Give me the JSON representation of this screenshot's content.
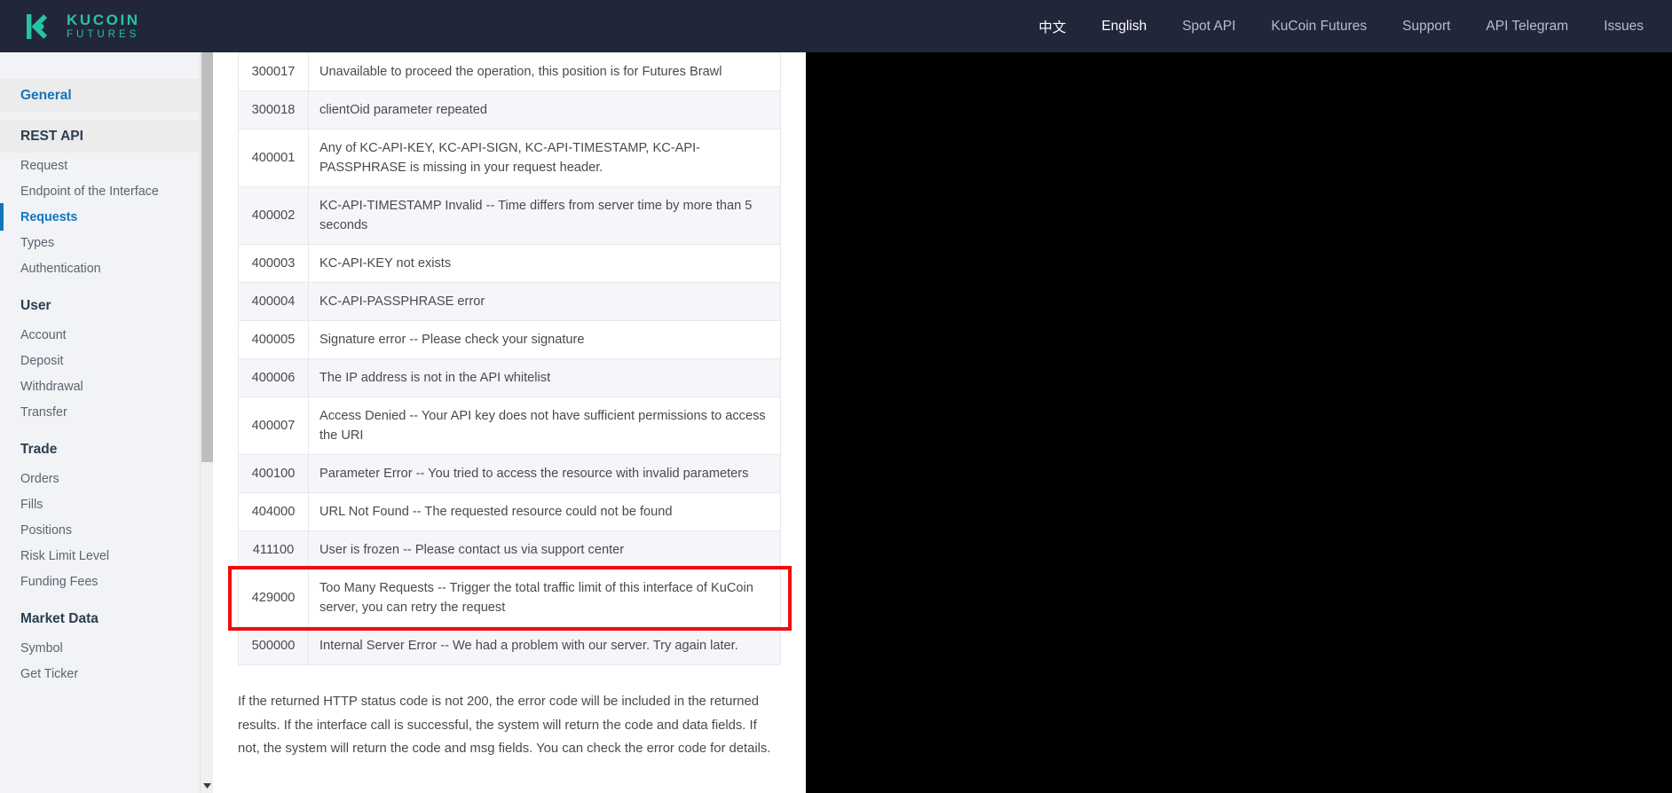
{
  "header": {
    "brand": {
      "title": "KUCOIN",
      "subtitle": "FUTURES",
      "logo_icon": "kucoin-k-logo",
      "color": "#27c3a4"
    },
    "nav": [
      {
        "label": "中文",
        "name": "nav-link-chinese",
        "active": false
      },
      {
        "label": "English",
        "name": "nav-link-english",
        "active": true
      },
      {
        "label": "Spot API",
        "name": "nav-link-spot-api",
        "active": false
      },
      {
        "label": "KuCoin Futures",
        "name": "nav-link-kucoin-futures",
        "active": false
      },
      {
        "label": "Support",
        "name": "nav-link-support",
        "active": false
      },
      {
        "label": "API Telegram",
        "name": "nav-link-api-telegram",
        "active": false
      },
      {
        "label": "Issues",
        "name": "nav-link-issues",
        "active": false
      }
    ],
    "background": "#222639"
  },
  "sidebar": {
    "groups": [
      {
        "title": "General",
        "style": "shaded-link",
        "items": []
      },
      {
        "title": "REST API",
        "style": "shaded",
        "items": [
          {
            "label": "Request",
            "active": false
          },
          {
            "label": "Endpoint of the Interface",
            "active": false
          },
          {
            "label": "Requests",
            "active": true
          },
          {
            "label": "Types",
            "active": false
          },
          {
            "label": "Authentication",
            "active": false
          }
        ]
      },
      {
        "title": "User",
        "style": "plain",
        "items": [
          {
            "label": "Account",
            "active": false
          },
          {
            "label": "Deposit",
            "active": false
          },
          {
            "label": "Withdrawal",
            "active": false
          },
          {
            "label": "Transfer",
            "active": false
          }
        ]
      },
      {
        "title": "Trade",
        "style": "plain",
        "items": [
          {
            "label": "Orders",
            "active": false
          },
          {
            "label": "Fills",
            "active": false
          },
          {
            "label": "Positions",
            "active": false
          },
          {
            "label": "Risk Limit Level",
            "active": false
          },
          {
            "label": "Funding Fees",
            "active": false
          }
        ]
      },
      {
        "title": "Market Data",
        "style": "plain",
        "items": [
          {
            "label": "Symbol",
            "active": false
          },
          {
            "label": "Get Ticker",
            "active": false
          }
        ]
      }
    ],
    "active_accent": "#1176bc"
  },
  "scrollbar": {
    "name": "sidebar-scrollbar",
    "down_arrow_icon": "chevron-down-icon"
  },
  "main": {
    "error_table": {
      "rows": [
        {
          "code": "300017",
          "message": "Unavailable to proceed the operation, this position is for Futures Brawl"
        },
        {
          "code": "300018",
          "message": "clientOid parameter repeated"
        },
        {
          "code": "400001",
          "message": "Any of KC-API-KEY, KC-API-SIGN, KC-API-TIMESTAMP, KC-API-PASSPHRASE is missing in your request header."
        },
        {
          "code": "400002",
          "message": "KC-API-TIMESTAMP Invalid -- Time differs from server time by more than 5 seconds"
        },
        {
          "code": "400003",
          "message": "KC-API-KEY not exists"
        },
        {
          "code": "400004",
          "message": "KC-API-PASSPHRASE error"
        },
        {
          "code": "400005",
          "message": "Signature error -- Please check your signature"
        },
        {
          "code": "400006",
          "message": "The IP address is not in the API whitelist"
        },
        {
          "code": "400007",
          "message": "Access Denied -- Your API key does not have sufficient permissions to access the URI"
        },
        {
          "code": "400100",
          "message": "Parameter Error -- You tried to access the resource with invalid parameters"
        },
        {
          "code": "404000",
          "message": "URL Not Found -- The requested resource could not be found"
        },
        {
          "code": "411100",
          "message": "User is frozen -- Please contact us via support center"
        },
        {
          "code": "429000",
          "message": "Too Many Requests -- Trigger the total traffic limit of this interface of KuCoin server, you can retry the request",
          "highlighted": true
        },
        {
          "code": "500000",
          "message": "Internal Server Error -- We had a problem with our server. Try again later."
        }
      ],
      "highlight_color": "#f00d0d"
    },
    "note": "If the returned HTTP status code is not 200, the error code will be included in the returned results. If the interface call is successful, the system will return the code and data fields. If not, the system will return the code and msg fields. You can check the error code for details."
  }
}
